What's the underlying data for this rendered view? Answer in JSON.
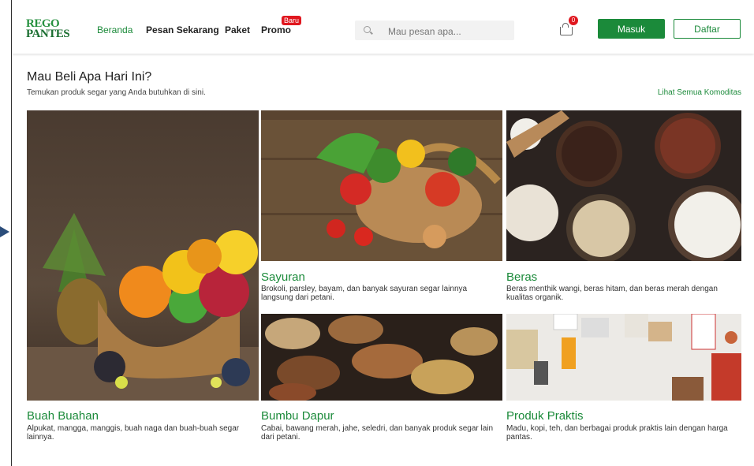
{
  "brand": {
    "line1": "REGO",
    "line2": "PANTES"
  },
  "nav": {
    "home": "Beranda",
    "order": "Pesan Sekarang",
    "package": "Paket",
    "promo": "Promo",
    "promo_badge": "Baru"
  },
  "search": {
    "placeholder": "Mau pesan apa..."
  },
  "cart": {
    "count": "0"
  },
  "auth": {
    "login": "Masuk",
    "register": "Daftar"
  },
  "section": {
    "title": "Mau Beli Apa Hari Ini?",
    "subtitle": "Temukan produk segar yang Anda butuhkan di sini.",
    "see_all": "Lihat Semua Komoditas"
  },
  "categories": [
    {
      "title": "Sayuran",
      "desc": "Brokoli, parsley, bayam, dan banyak sayuran segar lainnya langsung dari petani."
    },
    {
      "title": "Beras",
      "desc": "Beras menthik wangi, beras hitam, dan beras merah dengan kualitas organik."
    },
    {
      "title": "Buah Buahan",
      "desc": "Alpukat, mangga, manggis, buah naga dan buah-buah segar lainnya."
    },
    {
      "title": "Bumbu Dapur",
      "desc": "Cabai, bawang merah, jahe, seledri, dan banyak produk segar lain dari petani."
    },
    {
      "title": "Produk Praktis",
      "desc": "Madu, kopi, teh, dan berbagai produk praktis lain dengan harga pantas."
    }
  ],
  "colors": {
    "brand_green": "#1b8a3a",
    "badge_red": "#e0171f"
  }
}
